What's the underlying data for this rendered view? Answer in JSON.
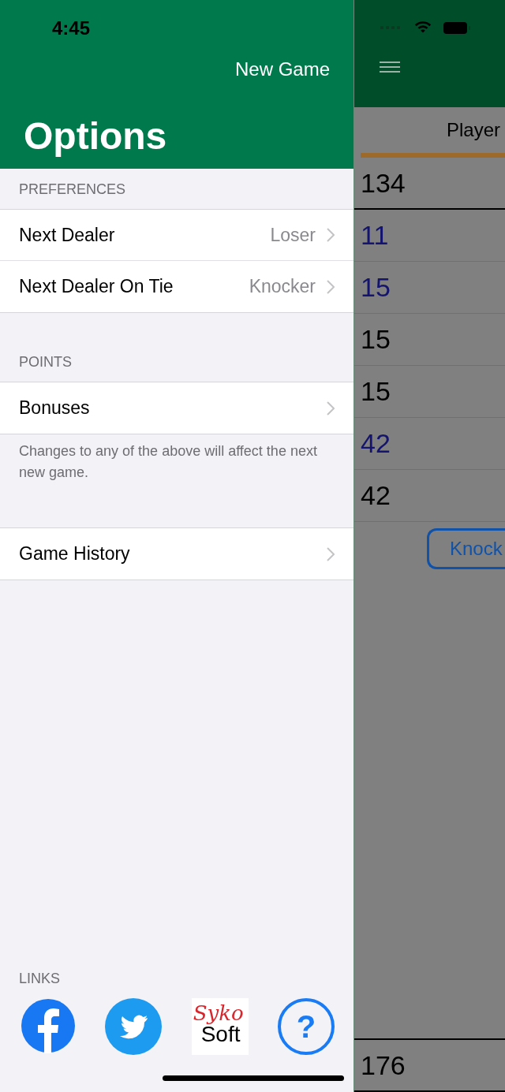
{
  "status_bar": {
    "time": "4:45"
  },
  "drawer": {
    "action": "New Game",
    "title": "Options",
    "sections": [
      {
        "header": "PREFERENCES",
        "rows": [
          {
            "label": "Next Dealer",
            "value": "Loser"
          },
          {
            "label": "Next Dealer On Tie",
            "value": "Knocker"
          }
        ]
      },
      {
        "header": "POINTS",
        "rows": [
          {
            "label": "Bonuses"
          }
        ],
        "footer": "Changes to any of the above will affect the next new game."
      },
      {
        "rows": [
          {
            "label": "Game History"
          }
        ]
      }
    ],
    "links": {
      "header": "LINKS",
      "items": [
        {
          "kind": "facebook"
        },
        {
          "kind": "twitter"
        },
        {
          "kind": "logo",
          "script": "Syko",
          "word": "Soft"
        },
        {
          "kind": "help",
          "glyph": "?"
        }
      ]
    }
  },
  "background": {
    "column": "Player",
    "total": "134",
    "scores": [
      {
        "value": "11",
        "color": "#14146e"
      },
      {
        "value": "15",
        "color": "#14146e"
      },
      {
        "value": "15",
        "color": "#000000"
      },
      {
        "value": "15",
        "color": "#000000"
      },
      {
        "value": "42",
        "color": "#14146e"
      },
      {
        "value": "42",
        "color": "#000000"
      }
    ],
    "button": "Knock",
    "final": "176"
  }
}
